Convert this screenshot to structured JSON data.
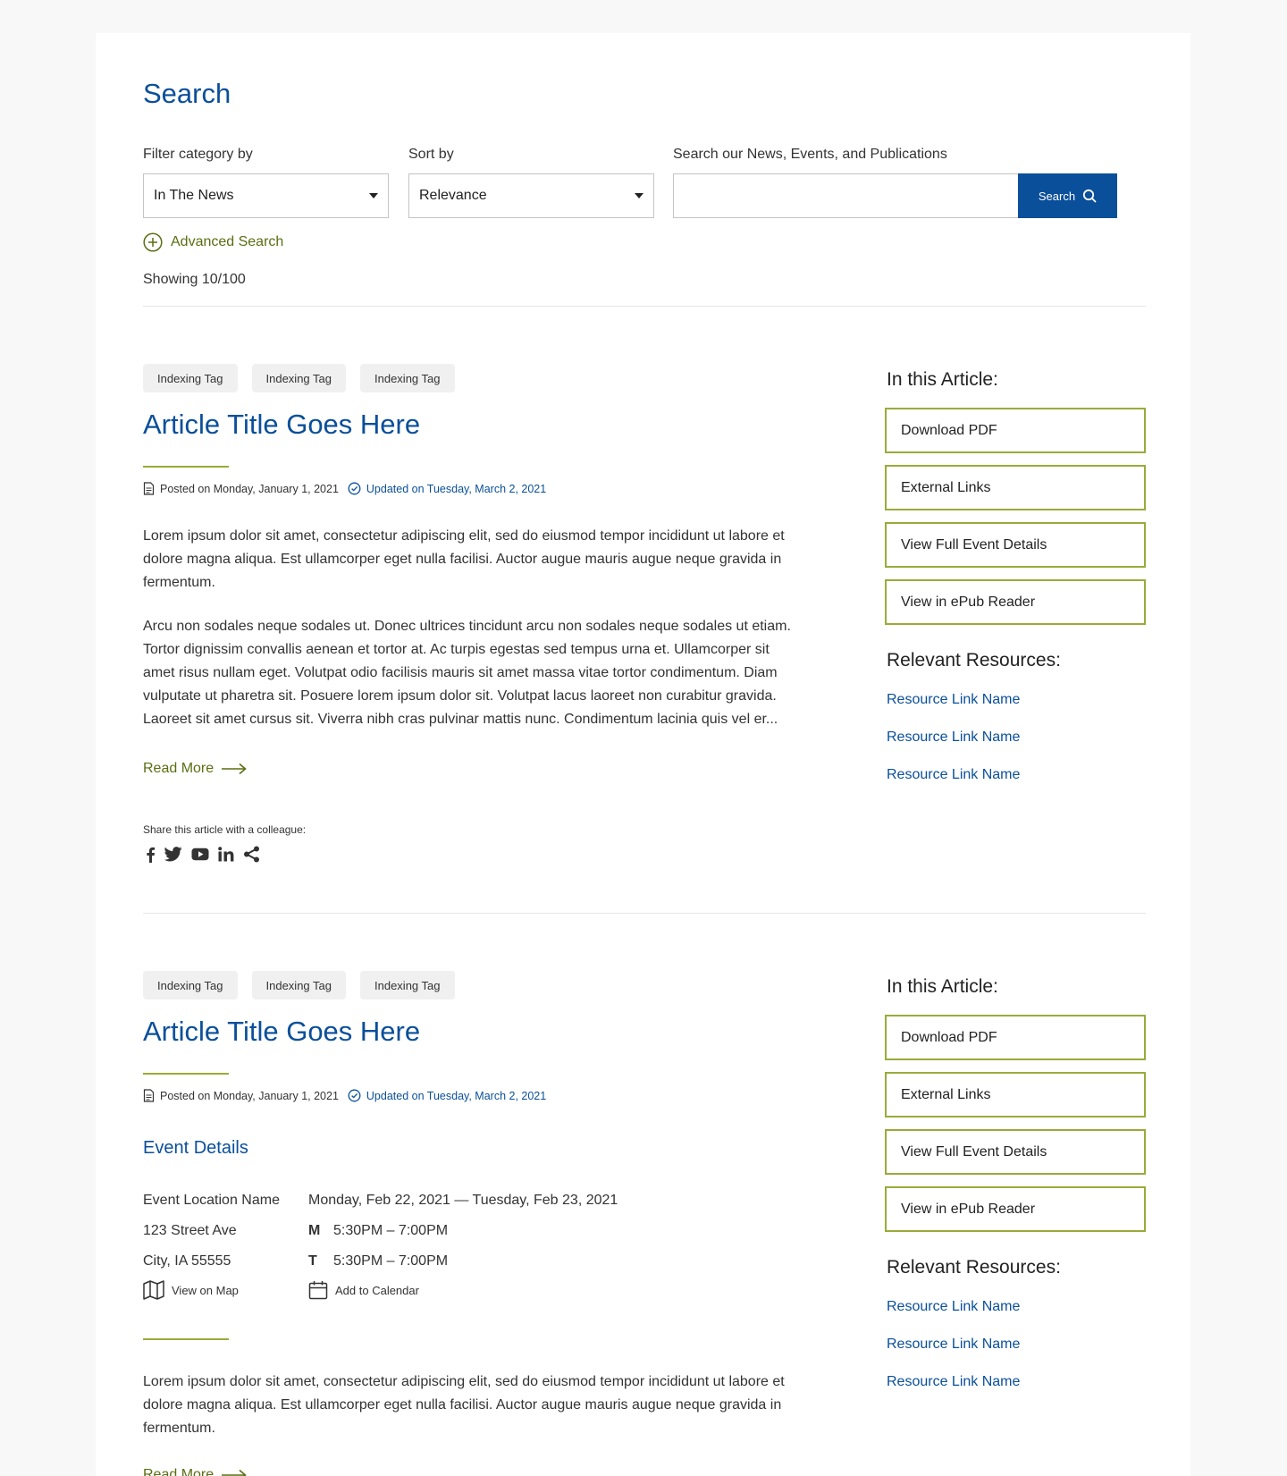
{
  "page": {
    "title": "Search",
    "filter_label": "Filter category by",
    "filter_value": "In The News",
    "sort_label": "Sort by",
    "sort_value": "Relevance",
    "search_label": "Search our News, Events, and Publications",
    "search_value": "",
    "search_button": "Search",
    "advanced_search": "Advanced Search",
    "showing": "Showing 10/100"
  },
  "colors": {
    "primary_blue": "#0a4f9a",
    "accent_olive": "#9aab3a",
    "link_olive": "#5a6e12"
  },
  "articles": [
    {
      "tags": [
        "Indexing Tag",
        "Indexing Tag",
        "Indexing Tag"
      ],
      "title": "Article Title Goes Here",
      "posted": "Posted on Monday, January 1, 2021",
      "updated": "Updated on Tuesday, March 2, 2021",
      "paragraphs": [
        "Lorem ipsum dolor sit amet, consectetur adipiscing elit, sed do eiusmod tempor incididunt ut labore et dolore magna aliqua. Est ullamcorper eget nulla facilisi. Auctor augue mauris augue neque gravida in fermentum.",
        "Arcu non sodales neque sodales ut. Donec ultrices tincidunt arcu non sodales neque sodales ut etiam. Tortor dignissim convallis aenean et tortor at. Ac turpis egestas sed tempus urna et. Ullamcorper sit amet risus nullam eget. Volutpat odio facilisis mauris sit amet massa vitae tortor condimentum. Diam vulputate ut pharetra sit. Posuere lorem ipsum dolor sit. Volutpat lacus laoreet non curabitur gravida. Laoreet sit amet cursus sit. Viverra nibh cras pulvinar mattis nunc. Condimentum lacinia quis vel er..."
      ],
      "read_more": "Read More",
      "share_label": "Share this article with a colleague:",
      "social_icons": [
        "facebook-icon",
        "twitter-icon",
        "youtube-icon",
        "linkedin-icon",
        "share-icon"
      ],
      "sidebar": {
        "heading": "In this Article:",
        "buttons": [
          "Download PDF",
          "External Links",
          "View Full Event Details",
          "View in ePub Reader"
        ],
        "resources_heading": "Relevant Resources:",
        "resources": [
          "Resource Link Name",
          "Resource Link Name",
          "Resource Link Name"
        ]
      }
    },
    {
      "tags": [
        "Indexing Tag",
        "Indexing Tag",
        "Indexing Tag"
      ],
      "title": "Article Title Goes Here",
      "posted": "Posted on Monday, January 1, 2021",
      "updated": "Updated on Tuesday, March 2, 2021",
      "event": {
        "heading": "Event Details",
        "location_name": "Event Location Name",
        "street": "123 Street Ave",
        "city": "City, IA 55555",
        "view_map": "View on Map",
        "date_range": "Monday, Feb 22, 2021 — Tuesday, Feb 23, 2021",
        "times": [
          {
            "day": "M",
            "time": "5:30PM – 7:00PM"
          },
          {
            "day": "T",
            "time": "5:30PM – 7:00PM"
          }
        ],
        "add_calendar": "Add to Calendar"
      },
      "paragraphs": [
        "Lorem ipsum dolor sit amet, consectetur adipiscing elit, sed do eiusmod tempor incididunt ut labore et dolore magna aliqua. Est ullamcorper eget nulla facilisi. Auctor augue mauris augue neque gravida in fermentum."
      ],
      "read_more": "Read More",
      "sidebar": {
        "heading": "In this Article:",
        "buttons": [
          "Download PDF",
          "External Links",
          "View Full Event Details",
          "View in ePub Reader"
        ],
        "resources_heading": "Relevant Resources:",
        "resources": [
          "Resource Link Name",
          "Resource Link Name",
          "Resource Link Name"
        ]
      }
    }
  ]
}
